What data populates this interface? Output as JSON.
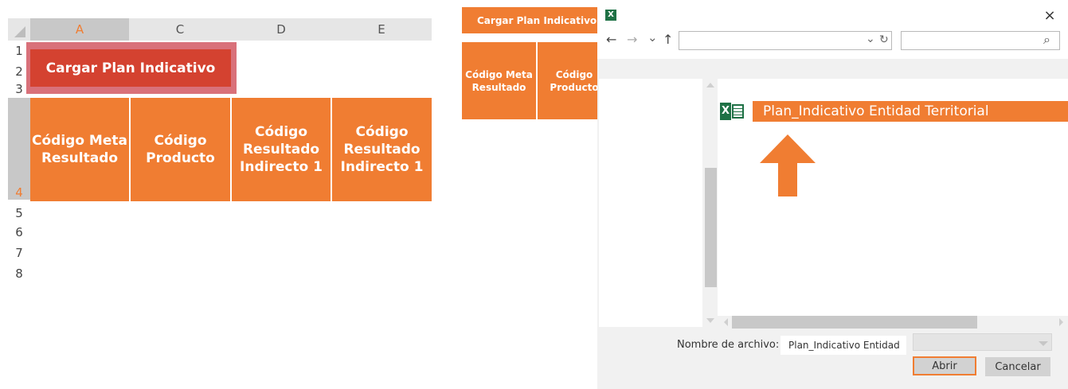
{
  "sheet": {
    "col_headers": [
      "A",
      "C",
      "D",
      "E"
    ],
    "row_numbers": [
      "1",
      "2",
      "3",
      "4",
      "5",
      "6",
      "7",
      "8"
    ],
    "button_label": "Cargar Plan Indicativo",
    "header_cells": [
      "Código Meta Resultado",
      "Código Producto",
      "Código Resultado Indirecto 1",
      "Código Resultado Indirecto 1"
    ],
    "accent_color": "#f07d32",
    "button_color": "#d44230"
  },
  "preview": {
    "button_label": "Cargar Plan Indicativo",
    "header_cells": [
      "Código Meta Resultado",
      "Código Producto"
    ]
  },
  "dialog": {
    "app_icon": "excel-icon",
    "close_glyph": "×",
    "nav": {
      "back": "←",
      "forward": "→",
      "dropdown": "⌄",
      "up": "↑",
      "refresh": "↻",
      "search": "⌕"
    },
    "file_item": "Plan_Indicativo Entidad Territorial",
    "filename_label": "Nombre de archivo:",
    "filename_value": "Plan_Indicativo Entidad",
    "open_button": "Abrir",
    "cancel_button": "Cancelar"
  }
}
